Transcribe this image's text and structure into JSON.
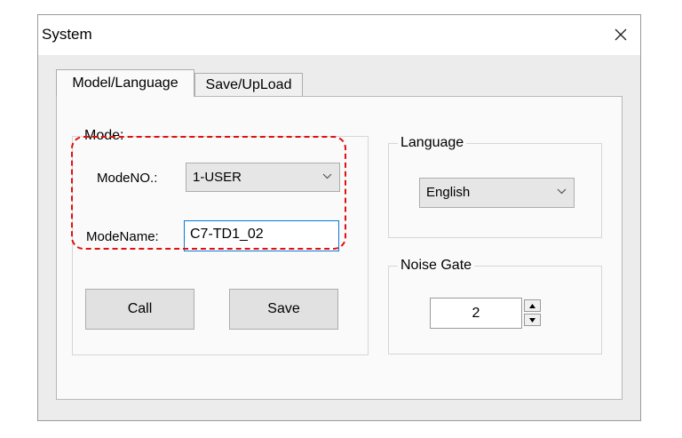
{
  "window": {
    "title": "System"
  },
  "tabs": [
    {
      "label": "Model/Language",
      "active": true
    },
    {
      "label": "Save/UpLoad",
      "active": false
    }
  ],
  "mode": {
    "group_label": "Mode:",
    "mode_no_label": "ModeNO.:",
    "mode_no_value": "1-USER",
    "mode_name_label": "ModeName:",
    "mode_name_value": "C7-TD1_02",
    "call_label": "Call",
    "save_label": "Save"
  },
  "language": {
    "group_label": "Language",
    "value": "English"
  },
  "noise_gate": {
    "group_label": "Noise Gate",
    "value": "2"
  },
  "icons": {
    "close": "close-icon",
    "dropdown": "chevron-down-icon",
    "spin_up": "spin-up-icon",
    "spin_down": "spin-down-icon"
  },
  "colors": {
    "highlight": "#e01010",
    "input_focus_border": "#0a7ad6"
  }
}
